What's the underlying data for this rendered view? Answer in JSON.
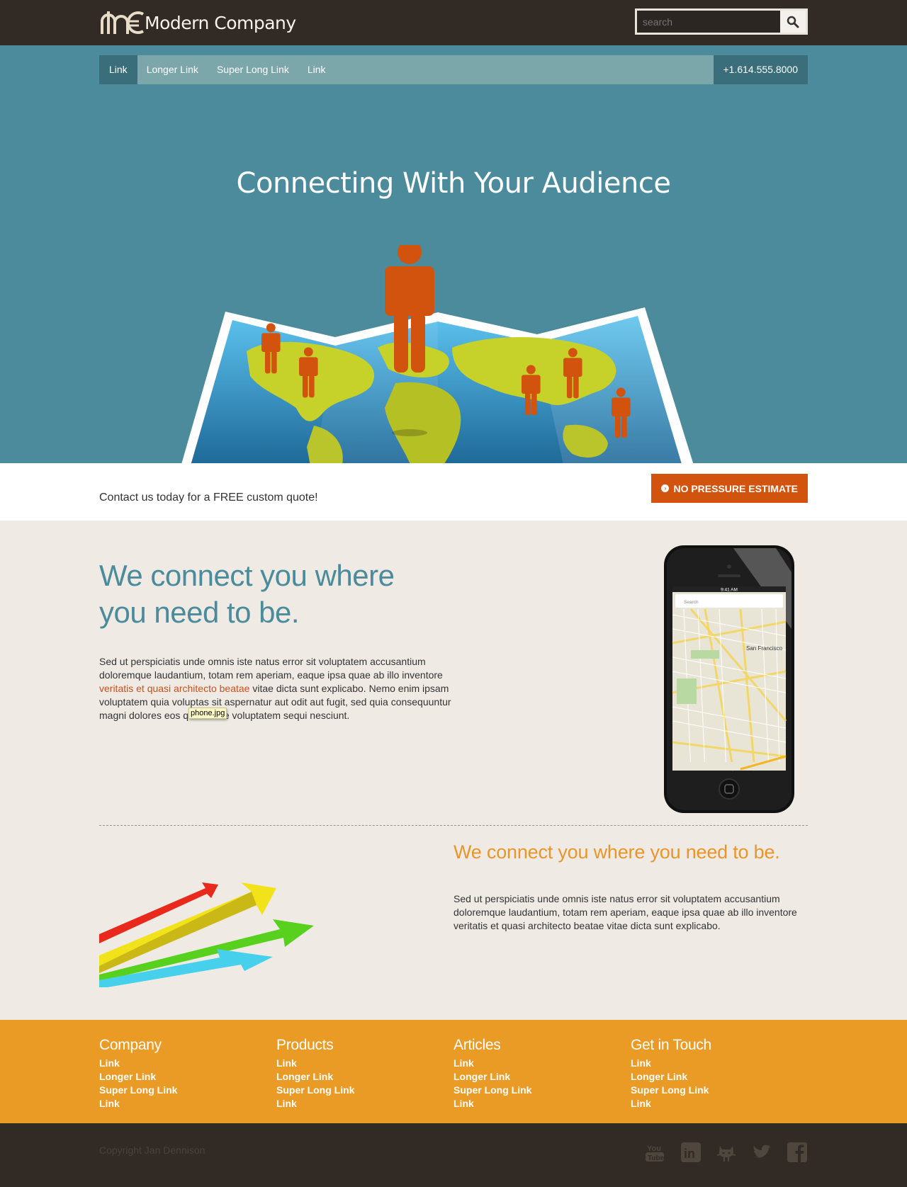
{
  "header": {
    "logo_text": "Modern Company",
    "search_placeholder": "search"
  },
  "nav": {
    "items": [
      {
        "label": "Link",
        "active": true
      },
      {
        "label": "Longer Link"
      },
      {
        "label": "Super Long Link"
      },
      {
        "label": "Link"
      }
    ],
    "phone": "+1.614.555.8000"
  },
  "hero": {
    "title": "Connecting With Your Audience"
  },
  "cta": {
    "text": "Contact us today for a FREE custom quote!",
    "button_label": "NO PRESSURE ESTIMATE"
  },
  "feature1": {
    "title": "We connect you where you need to be.",
    "text_before": "Sed ut perspiciatis unde omnis iste natus error sit voluptatem accusantium doloremque laudantium, totam rem aperiam, eaque ipsa quae ab illo inventore",
    "link_text": "veritatis et quasi architecto beatae",
    "text_after": "vitae dicta sunt explicabo. Nemo enim ipsam voluptatem quia voluptas sit aspernatur aut odit aut fugit, sed quia consequuntur magni dolores eos qui ratione voluptatem sequi nesciunt.",
    "tooltip": "phone.jpg",
    "phone_map": {
      "time": "9:41 AM",
      "search": "Search",
      "city": "San Francisco",
      "places": [
        "Lower Pacific Heights",
        "Geary Blvd",
        "Lone Mountain",
        "The Panhandle",
        "Ashbury Heights",
        "Mission Dolores",
        "Castro",
        "Mission District",
        "Dolores Heights",
        "Noe Valley",
        "Twin Peaks West",
        "Sunnyside",
        "Cesar Chav",
        "Mt Sutro Open Space Reserve",
        "17th St",
        "24th St",
        "Fell St",
        "Oak St",
        "Fillmore St",
        "Franklin St",
        "Guerrero St",
        "Clipper St",
        "San Jose Ave",
        "Bosworth St",
        "Google"
      ]
    }
  },
  "feature2": {
    "title": "We connect you where you need to be.",
    "text": "Sed ut perspiciatis unde omnis iste natus error sit voluptatem accusantium doloremque laudantium, totam rem aperiam, eaque ipsa quae ab illo inventore veritatis et quasi architecto beatae vitae dicta sunt explicabo."
  },
  "footer": {
    "columns": [
      {
        "title": "Company",
        "links": [
          "Link",
          "Longer Link",
          "Super Long Link",
          "Link"
        ]
      },
      {
        "title": "Products",
        "links": [
          "Link",
          "Longer Link",
          "Super Long Link",
          "Link"
        ]
      },
      {
        "title": "Articles",
        "links": [
          "Link",
          "Longer Link",
          "Super Long Link",
          "Link"
        ]
      },
      {
        "title": "Get in Touch",
        "links": [
          "Link",
          "Longer Link",
          "Super Long Link",
          "Link"
        ]
      }
    ],
    "copyright": "Copyright Jan Dennison",
    "social_icons": [
      "youtube-icon",
      "linkedin-icon",
      "github-icon",
      "twitter-icon",
      "facebook-icon"
    ]
  },
  "colors": {
    "dark": "#322a24",
    "teal": "#4b8b9b",
    "orange": "#d1530d",
    "footer_orange": "#ea9b25",
    "cream": "#efebe4"
  }
}
